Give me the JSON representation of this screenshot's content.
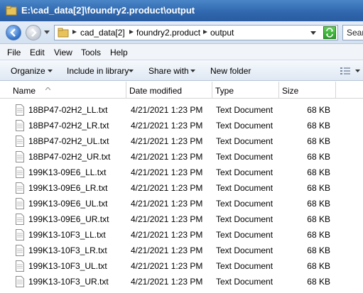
{
  "window": {
    "title": "E:\\cad_data[2]\\foundry2.product\\output"
  },
  "address": {
    "crumbs": [
      "cad_data[2]",
      "foundry2.product",
      "output"
    ],
    "search_placeholder": "Sear"
  },
  "menu": {
    "items": [
      "File",
      "Edit",
      "View",
      "Tools",
      "Help"
    ]
  },
  "commands": {
    "organize": "Organize",
    "include_in_library": "Include in library",
    "share_with": "Share with",
    "new_folder": "New folder"
  },
  "columns": {
    "name": "Name",
    "date_modified": "Date modified",
    "type": "Type",
    "size": "Size"
  },
  "files": [
    {
      "name": "18BP47-02H2_LL.txt",
      "date": "4/21/2021 1:23 PM",
      "type": "Text Document",
      "size": "68 KB"
    },
    {
      "name": "18BP47-02H2_LR.txt",
      "date": "4/21/2021 1:23 PM",
      "type": "Text Document",
      "size": "68 KB"
    },
    {
      "name": "18BP47-02H2_UL.txt",
      "date": "4/21/2021 1:23 PM",
      "type": "Text Document",
      "size": "68 KB"
    },
    {
      "name": "18BP47-02H2_UR.txt",
      "date": "4/21/2021 1:23 PM",
      "type": "Text Document",
      "size": "68 KB"
    },
    {
      "name": "199K13-09E6_LL.txt",
      "date": "4/21/2021 1:23 PM",
      "type": "Text Document",
      "size": "68 KB"
    },
    {
      "name": "199K13-09E6_LR.txt",
      "date": "4/21/2021 1:23 PM",
      "type": "Text Document",
      "size": "68 KB"
    },
    {
      "name": "199K13-09E6_UL.txt",
      "date": "4/21/2021 1:23 PM",
      "type": "Text Document",
      "size": "68 KB"
    },
    {
      "name": "199K13-09E6_UR.txt",
      "date": "4/21/2021 1:23 PM",
      "type": "Text Document",
      "size": "68 KB"
    },
    {
      "name": "199K13-10F3_LL.txt",
      "date": "4/21/2021 1:23 PM",
      "type": "Text Document",
      "size": "68 KB"
    },
    {
      "name": "199K13-10F3_LR.txt",
      "date": "4/21/2021 1:23 PM",
      "type": "Text Document",
      "size": "68 KB"
    },
    {
      "name": "199K13-10F3_UL.txt",
      "date": "4/21/2021 1:23 PM",
      "type": "Text Document",
      "size": "68 KB"
    },
    {
      "name": "199K13-10F3_UR.txt",
      "date": "4/21/2021 1:23 PM",
      "type": "Text Document",
      "size": "68 KB"
    }
  ]
}
